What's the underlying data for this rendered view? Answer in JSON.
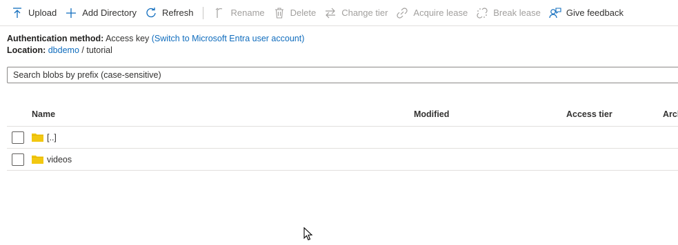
{
  "toolbar": {
    "buttons": [
      {
        "label": "Upload",
        "icon": "upload-icon",
        "disabled": false
      },
      {
        "label": "Add Directory",
        "icon": "plus-icon",
        "disabled": false
      },
      {
        "label": "Refresh",
        "icon": "refresh-icon",
        "disabled": false
      },
      {
        "label": "Rename",
        "icon": "rename-icon",
        "disabled": true
      },
      {
        "label": "Delete",
        "icon": "trash-icon",
        "disabled": true
      },
      {
        "label": "Change tier",
        "icon": "swap-icon",
        "disabled": true
      },
      {
        "label": "Acquire lease",
        "icon": "link-icon",
        "disabled": true
      },
      {
        "label": "Break lease",
        "icon": "broken-link-icon",
        "disabled": true
      },
      {
        "label": "Give feedback",
        "icon": "feedback-icon",
        "disabled": false
      }
    ]
  },
  "meta": {
    "auth_label": "Authentication method:",
    "auth_value": "Access key",
    "auth_link": "(Switch to Microsoft Entra user account)",
    "location_label": "Location:",
    "location_container": "dbdemo",
    "location_sep": "/",
    "location_path": "tutorial"
  },
  "search": {
    "placeholder": "Search blobs by prefix (case-sensitive)"
  },
  "table": {
    "columns": [
      "Name",
      "Modified",
      "Access tier",
      "Arch"
    ],
    "rows": [
      {
        "name": "[..]",
        "icon": "folder-icon"
      },
      {
        "name": "videos",
        "icon": "folder-icon"
      }
    ]
  },
  "colors": {
    "link": "#0f6cbd",
    "folder": "#f2c811",
    "disabled_text": "#a19f9d"
  }
}
